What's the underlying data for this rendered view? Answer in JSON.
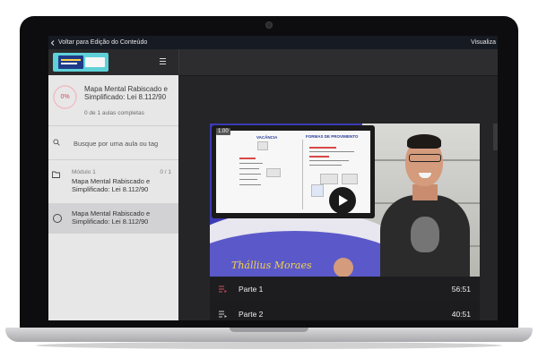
{
  "topbar": {
    "back_label": "Voltar para Edição do Conteúdo",
    "right_label": "Visualiza"
  },
  "course": {
    "progress_percent": "0%",
    "progress_value": 0,
    "title": "Mapa Mental Rabiscado e Simplificado: Lei 8.112/90",
    "completed": "0 de 1 aulas completas"
  },
  "search": {
    "placeholder": "Busque por uma aula ou tag"
  },
  "module": {
    "label": "Módulo 1",
    "count": "0 / 1",
    "title": "Mapa Mental Rabiscado e Simplificado: Lei 8.112/90"
  },
  "lesson": {
    "title": "Mapa Mental Rabiscado e Simplificado: Lei 8.112/90"
  },
  "video": {
    "badge": "1.00",
    "slide_title_1": "VACÂNCIA",
    "slide_title_2": "FORMAS DE PROVIMENTO",
    "signature": "Thállius Moraes"
  },
  "parts": [
    {
      "label": "Parte 1",
      "duration": "56:51"
    },
    {
      "label": "Parte 2",
      "duration": "40:51"
    }
  ],
  "colors": {
    "progress_ring": "#d24b5a",
    "video_bg": "#3b3ab5",
    "signature": "#f3d24b"
  },
  "icons": {
    "back": "chevron-left-icon",
    "menu": "hamburger-icon",
    "search": "search-icon",
    "module": "folder-icon",
    "play": "play-icon",
    "part": "playlist-icon"
  }
}
